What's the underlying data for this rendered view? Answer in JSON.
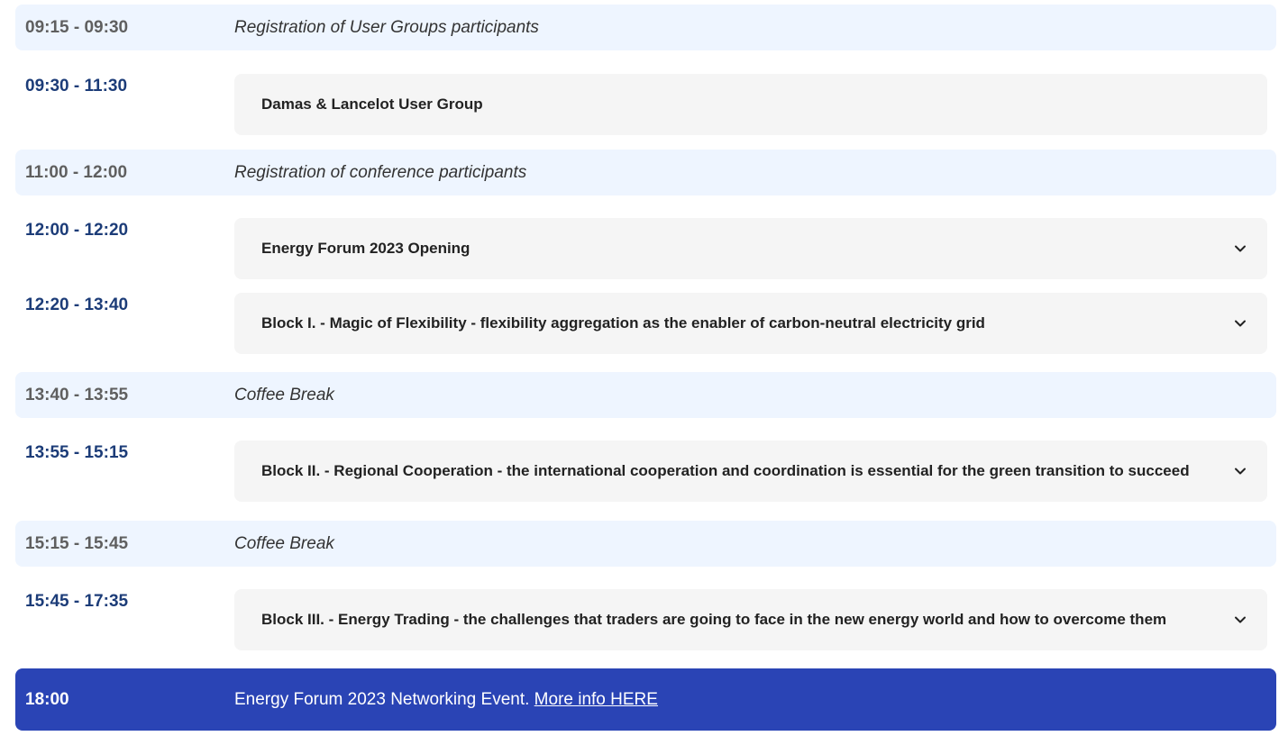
{
  "colors": {
    "info_background": "#eef5ff",
    "card_background": "#f5f5f5",
    "session_time": "#1c3c78",
    "info_time": "#5f5f5f",
    "highlight_background": "#2a44b5"
  },
  "agenda": [
    {
      "kind": "info",
      "time": "09:15 - 09:30",
      "text": "Registration of User Groups participants"
    },
    {
      "kind": "session",
      "time": "09:30 - 11:30",
      "title": "Damas & Lancelot User Group",
      "expandable": false
    },
    {
      "kind": "info",
      "time": "11:00 - 12:00",
      "text": "Registration of conference participants"
    },
    {
      "kind": "session",
      "time": "12:00 - 12:20",
      "title": "Energy Forum 2023 Opening",
      "expandable": true,
      "icon": "chevron-down-icon"
    },
    {
      "kind": "session",
      "time": "12:20 - 13:40",
      "title": "Block I. - Magic of Flexibility - flexibility aggregation as the enabler of carbon-neutral electricity grid",
      "expandable": true,
      "icon": "chevron-down-icon"
    },
    {
      "kind": "info",
      "time": "13:40 - 13:55",
      "text": "Coffee Break"
    },
    {
      "kind": "session",
      "time": "13:55 - 15:15",
      "title": "Block II. - Regional Cooperation - the international cooperation and coordination is essential for the green transition to succeed",
      "expandable": true,
      "icon": "chevron-down-icon"
    },
    {
      "kind": "info",
      "time": "15:15 - 15:45",
      "text": "Coffee Break"
    },
    {
      "kind": "session",
      "time": "15:45 - 17:35",
      "title": "Block III. - Energy Trading - the challenges that traders are going to face in the new energy world and how to overcome them",
      "expandable": true,
      "icon": "chevron-down-icon"
    },
    {
      "kind": "highlight",
      "time": "18:00",
      "text": "Energy Forum 2023 Networking Event. ",
      "link_text": "More info HERE"
    }
  ]
}
